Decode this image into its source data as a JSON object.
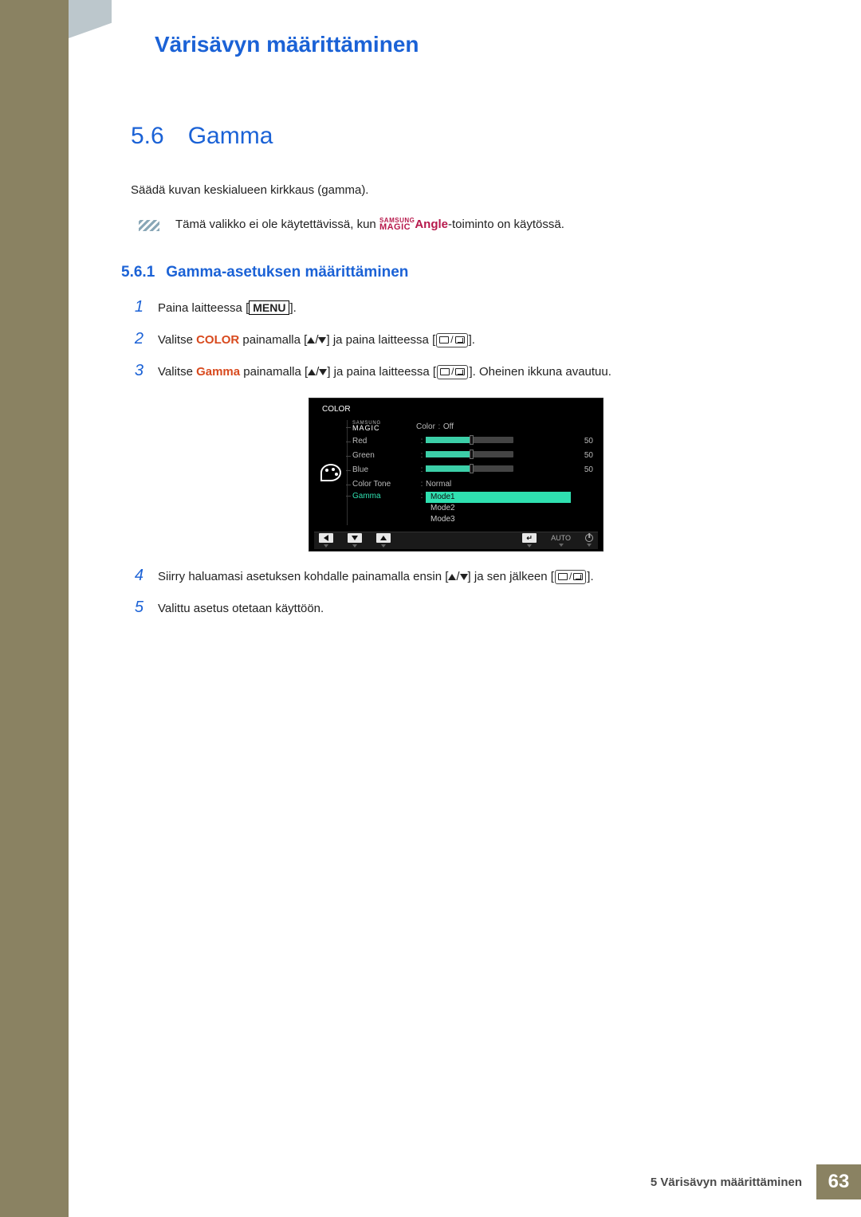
{
  "header": {
    "title": "Värisävyn määrittäminen"
  },
  "section": {
    "number": "5.6",
    "title": "Gamma",
    "intro": "Säädä kuvan keskialueen kirkkaus (gamma).",
    "note_before": "Tämä valikko ei ole käytettävissä, kun ",
    "note_brand_top": "SAMSUNG",
    "note_brand_bot": "MAGIC",
    "note_angle": "Angle",
    "note_after": "-toiminto on käytössä."
  },
  "subsection": {
    "number": "5.6.1",
    "title": "Gamma-asetuksen määrittäminen"
  },
  "steps": {
    "s1_a": "Paina laitteessa [",
    "s1_menu": "MENU",
    "s1_b": "].",
    "s2_a": "Valitse ",
    "s2_color": "COLOR",
    "s2_b": " painamalla [",
    "s2_c": "] ja paina laitteessa [",
    "s2_d": "].",
    "s3_a": "Valitse ",
    "s3_gamma": "Gamma",
    "s3_b": " painamalla [",
    "s3_c": "] ja paina laitteessa [",
    "s3_d": "]. Oheinen ikkuna avautuu.",
    "s4_a": "Siirry haluamasi asetuksen kohdalle painamalla ensin [",
    "s4_b": "] ja sen jälkeen [",
    "s4_c": "].",
    "s5": "Valittu asetus otetaan käyttöön."
  },
  "osd": {
    "title": "COLOR",
    "magic_top": "SAMSUNG",
    "magic_bot": "MAGIC",
    "rows": {
      "magic_color": {
        "label": "Color",
        "value": "Off"
      },
      "red": {
        "label": "Red",
        "value": 50
      },
      "green": {
        "label": "Green",
        "value": 50
      },
      "blue": {
        "label": "Blue",
        "value": 50
      },
      "color_tone": {
        "label": "Color Tone",
        "value": "Normal"
      },
      "gamma": {
        "label": "Gamma",
        "modes": [
          "Mode1",
          "Mode2",
          "Mode3"
        ],
        "selected": 0
      }
    },
    "footer_auto": "AUTO"
  },
  "footer": {
    "chapter": "5 Värisävyn määrittäminen",
    "page": "63"
  }
}
